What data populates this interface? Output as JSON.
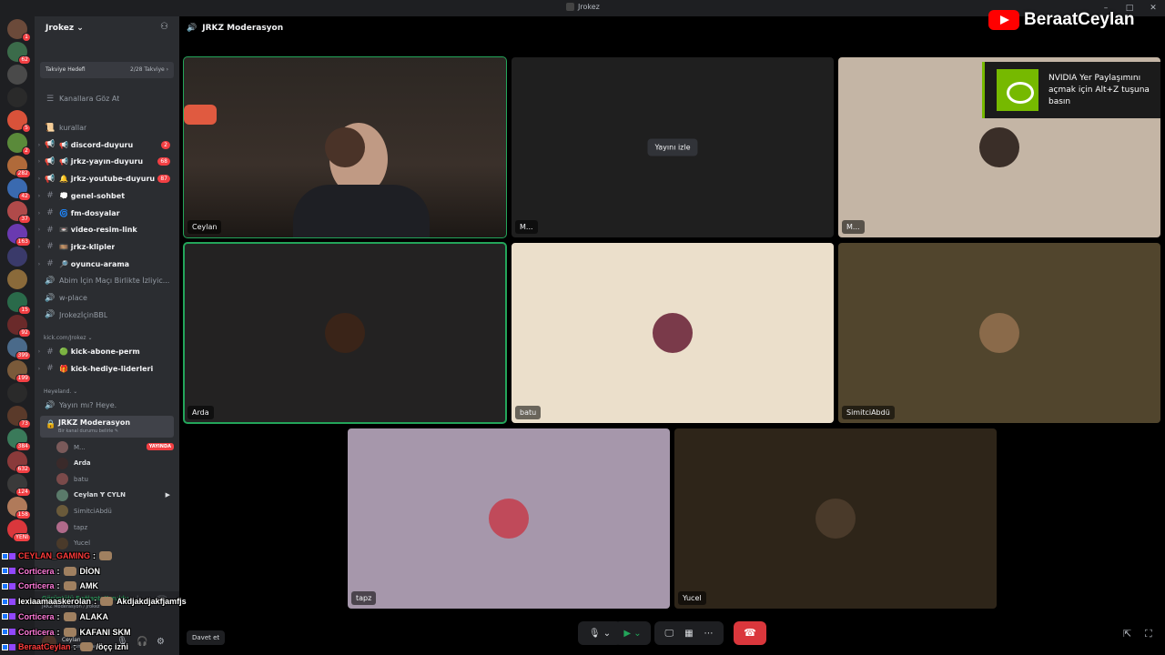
{
  "window": {
    "title": "Jrokez",
    "controls": [
      "–",
      "□",
      "✕"
    ]
  },
  "overlay": {
    "youtube_name": "BeraatCeylan"
  },
  "guilds": {
    "badges": [
      "1",
      "62",
      "",
      "",
      "5",
      "2",
      "282",
      "42",
      "37",
      "163",
      "",
      "",
      "15",
      "92",
      "399",
      "199",
      "",
      "73",
      "384",
      "632",
      "124",
      "158",
      "YENİ"
    ],
    "colors": [
      "#6b4a3a",
      "#3b6b4a",
      "#4a4a4a",
      "#2a2a2a",
      "#d9523a",
      "#5a8a3a",
      "#b06a3a",
      "#3a6ab0",
      "#b04a4a",
      "#6a3ab0",
      "#3a3a6a",
      "#8a6a3a",
      "#2a6a4a",
      "#6a2a2a",
      "#4a6a8a",
      "#7a5a3a",
      "#2a2a2a",
      "#5a3a2a",
      "#3a7a5a",
      "#8a3a3a",
      "#3a3a3a",
      "#b07a5a",
      "#da373c"
    ]
  },
  "server": {
    "name": "Jrokez ⌄",
    "boost_label": "Takviye Hedefi",
    "boost_count": "2/28 Takviye ›",
    "browse": "Kanallara Göz At"
  },
  "channels": [
    {
      "arrow": "",
      "icon": "📜",
      "label": "kurallar",
      "bold": false,
      "badge": ""
    },
    {
      "arrow": "›",
      "icon": "📢",
      "label": "📢 discord-duyuru",
      "bold": true,
      "badge": "2"
    },
    {
      "arrow": "›",
      "icon": "📢",
      "label": "📢 jrkz-yayın-duyuru",
      "bold": true,
      "badge": "68"
    },
    {
      "arrow": "›",
      "icon": "📢",
      "label": "🔔 jrkz-youtube-duyuru",
      "bold": true,
      "badge": "87"
    },
    {
      "arrow": "›",
      "icon": "#",
      "label": "💭 genel-sohbet",
      "bold": true,
      "badge": ""
    },
    {
      "arrow": "›",
      "icon": "#",
      "label": "🌀 fm-dosyalar",
      "bold": true,
      "badge": ""
    },
    {
      "arrow": "›",
      "icon": "#",
      "label": "📼 video-resim-link",
      "bold": true,
      "badge": ""
    },
    {
      "arrow": "›",
      "icon": "#",
      "label": "🎞️ jrkz-klipler",
      "bold": true,
      "badge": ""
    },
    {
      "arrow": "›",
      "icon": "#",
      "label": "🔎 oyuncu-arama",
      "bold": true,
      "badge": ""
    },
    {
      "arrow": "",
      "icon": "🔊",
      "label": "Abim İçin Maçı Birlikte İzliyic...",
      "bold": false,
      "badge": ""
    },
    {
      "arrow": "",
      "icon": "🔊",
      "label": "w-place",
      "bold": false,
      "badge": ""
    },
    {
      "arrow": "",
      "icon": "🔊",
      "label": "JrokezİçinBBL",
      "bold": false,
      "badge": ""
    }
  ],
  "category_kick": "kick.com/Jrokez ⌄",
  "kick_channels": [
    {
      "arrow": "›",
      "icon": "#",
      "label": "🟢 kick-abone-perm",
      "bold": true
    },
    {
      "arrow": "›",
      "icon": "#",
      "label": "🎁 kick-hediye-liderleri",
      "bold": true
    }
  ],
  "category_heyeland": "Heyeland. ⌄",
  "voice_channel_prev": "Yayın mı? Heye.",
  "voice_channel": {
    "name": "JRKZ Moderasyon",
    "status": "Bir kanal durumu belirle ✎"
  },
  "voice_users": [
    {
      "name": "M...",
      "bold": false,
      "live": "YAYINDA",
      "color": "#7a5a5a"
    },
    {
      "name": "Arda",
      "bold": true,
      "live": "",
      "color": "#3a2a2a"
    },
    {
      "name": "batu",
      "bold": false,
      "live": "",
      "color": "#7a4a4a"
    },
    {
      "name": "Ceylan  Ɏ CYLN",
      "bold": true,
      "live": "",
      "color": "#5a7a6a"
    },
    {
      "name": "SimitciAbdü",
      "bold": false,
      "live": "",
      "color": "#6a5a3a"
    },
    {
      "name": "tapz",
      "bold": false,
      "live": "",
      "color": "#b06a8a"
    },
    {
      "name": "Yucel",
      "bold": false,
      "live": "",
      "color": "#4a3a2a"
    }
  ],
  "voice_panel": {
    "status": "Görüntülü Bağlantı Kuruldu",
    "server": "JRKZ Moderasyon / Jrokez",
    "user": "Ceylan",
    "user_sub": "kick.com/beraatceyl..."
  },
  "chat_overlay": [
    {
      "user": "CEYLAN_GAMING",
      "msg": "",
      "color": "#ff3b3b"
    },
    {
      "user": "Corticera",
      "msg": "DİON",
      "color": "#ff7ad9"
    },
    {
      "user": "Corticera",
      "msg": "AMK",
      "color": "#ff7ad9"
    },
    {
      "user": "lexiaamaaskerolan",
      "msg": "Akdjakdjakfjamfjs",
      "color": "#ffffff"
    },
    {
      "user": "Corticera",
      "msg": "ALAKA",
      "color": "#ff7ad9"
    },
    {
      "user": "Corticera",
      "msg": "KAFANI SKM",
      "color": "#ff7ad9"
    },
    {
      "user": "BeraatCeylan",
      "msg": "/öçç izni",
      "color": "#ff3b3b"
    }
  ],
  "main": {
    "channel_title": "JRKZ Moderasyon",
    "watch_stream": "Yayını izle",
    "invite": "Davet et"
  },
  "tiles": [
    {
      "name": "Ceylan",
      "bg": "#2a2522",
      "speaking": true,
      "avatar": "#4a3328",
      "video": true
    },
    {
      "name": "M...",
      "bg": "#1f1f1f",
      "speaking": false,
      "avatar": "",
      "stream": true
    },
    {
      "name": "M...",
      "bg": "#c4b5a5",
      "speaking": false,
      "avatar": "#3a2e28"
    },
    {
      "name": "Arda",
      "bg": "#232222",
      "speaking": true,
      "avatar": "#3a2418"
    },
    {
      "name": "batu",
      "bg": "#ebdfcb",
      "speaking": false,
      "avatar": "#7a3a4a"
    },
    {
      "name": "SimitciAbdü",
      "bg": "#51452d",
      "speaking": false,
      "avatar": "#8a6a4a"
    },
    {
      "name": "tapz",
      "bg": "#a697ab",
      "speaking": false,
      "avatar": "#c04a5a"
    },
    {
      "name": "Yucel",
      "bg": "#2e2519",
      "speaking": false,
      "avatar": "#4a3a2a"
    }
  ],
  "nvidia": {
    "text": "NVIDIA Yer Paylaşımını açmak için Alt+Z tuşuna basın"
  }
}
